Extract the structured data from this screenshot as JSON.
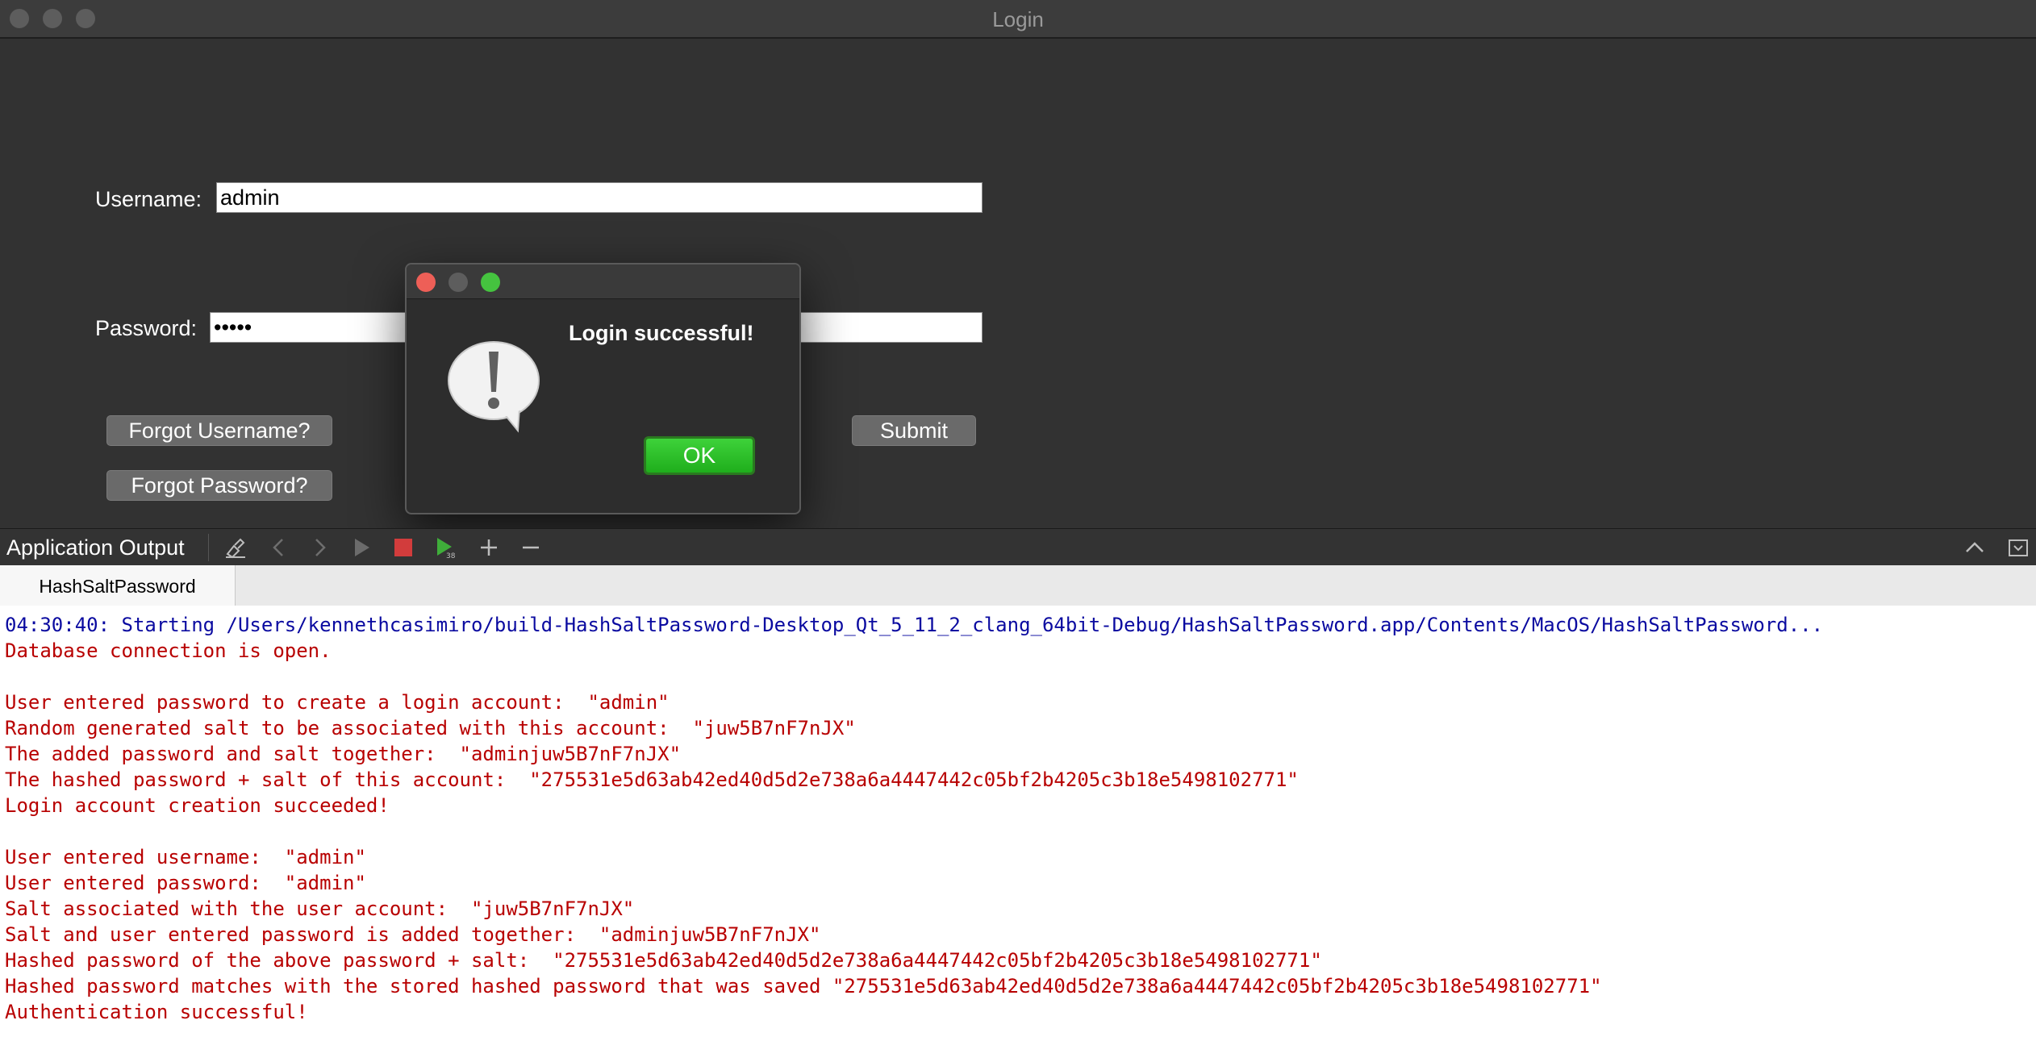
{
  "window": {
    "title": "Login"
  },
  "form": {
    "username_label": "Username:",
    "username_value": "admin",
    "password_label": "Password:",
    "password_value": "•••••",
    "forgot_username_label": "Forgot Username?",
    "forgot_password_label": "Forgot Password?",
    "submit_label": "Submit"
  },
  "dialog": {
    "message": "Login successful!",
    "ok_label": "OK",
    "icon": "alert-exclamation-icon"
  },
  "output_pane": {
    "title": "Application Output",
    "tab_label": "HashSaltPassword",
    "lines": [
      "04:30:40: Starting /Users/kennethcasimiro/build-HashSaltPassword-Desktop_Qt_5_11_2_clang_64bit-Debug/HashSaltPassword.app/Contents/MacOS/HashSaltPassword...",
      "Database connection is open.",
      "User entered password to create a login account:  \"admin\"",
      "Random generated salt to be associated with this account:  \"juw5B7nF7nJX\"",
      "The added password and salt together:  \"adminjuw5B7nF7nJX\"",
      "The hashed password + salt of this account:  \"275531e5d63ab42ed40d5d2e738a6a4447442c05bf2b4205c3b18e5498102771\"",
      "Login account creation succeeded!",
      "User entered username:  \"admin\"",
      "User entered password:  \"admin\"",
      "Salt associated with the user account:  \"juw5B7nF7nJX\"",
      "Salt and user entered password is added together:  \"adminjuw5B7nF7nJX\"",
      "Hashed password of the above password + salt:  \"275531e5d63ab42ed40d5d2e738a6a4447442c05bf2b4205c3b18e5498102771\"",
      "Hashed password matches with the stored hashed password that was saved \"275531e5d63ab42ed40d5d2e738a6a4447442c05bf2b4205c3b18e5498102771\"",
      "Authentication successful!"
    ]
  },
  "colors": {
    "window_bg": "#323232",
    "ok_button": "#2fc22b",
    "log_start": "#0a0aa0",
    "log_text": "#b80000",
    "close": "#ee5f57",
    "minimize": "#5d5d5d",
    "zoom": "#45c33f"
  }
}
